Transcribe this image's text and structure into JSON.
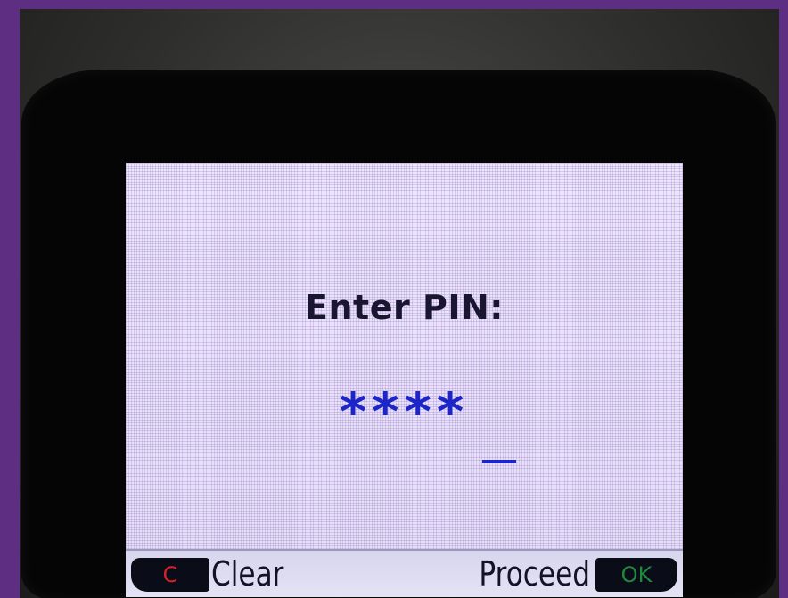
{
  "screen": {
    "prompt": "Enter PIN:",
    "pin_mask": "****",
    "cursor": "_"
  },
  "softkeys": {
    "left_key": "C",
    "left_label": "Clear",
    "right_label": "Proceed",
    "right_key": "OK"
  },
  "colors": {
    "background": "#5d2e82",
    "screen": "#e6e3f7",
    "prompt_text": "#1a1530",
    "pin_text": "#1b25c8",
    "clear_key_text": "#d8202a",
    "ok_key_text": "#1e8a3c"
  }
}
